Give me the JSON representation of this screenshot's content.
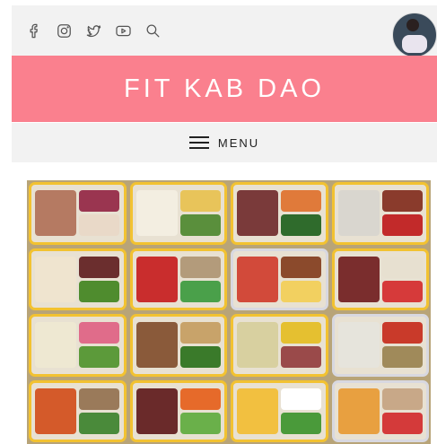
{
  "header": {
    "social_icons": [
      "facebook-icon",
      "instagram-icon",
      "twitter-icon",
      "youtube-icon",
      "search-icon"
    ]
  },
  "banner": {
    "title": "FIT KAB DAO"
  },
  "nav": {
    "menu_label": "MENU"
  },
  "colors": {
    "brand_pink": "#fa808e",
    "bar_grey": "#f2f2f2",
    "icon_grey": "#555555"
  }
}
